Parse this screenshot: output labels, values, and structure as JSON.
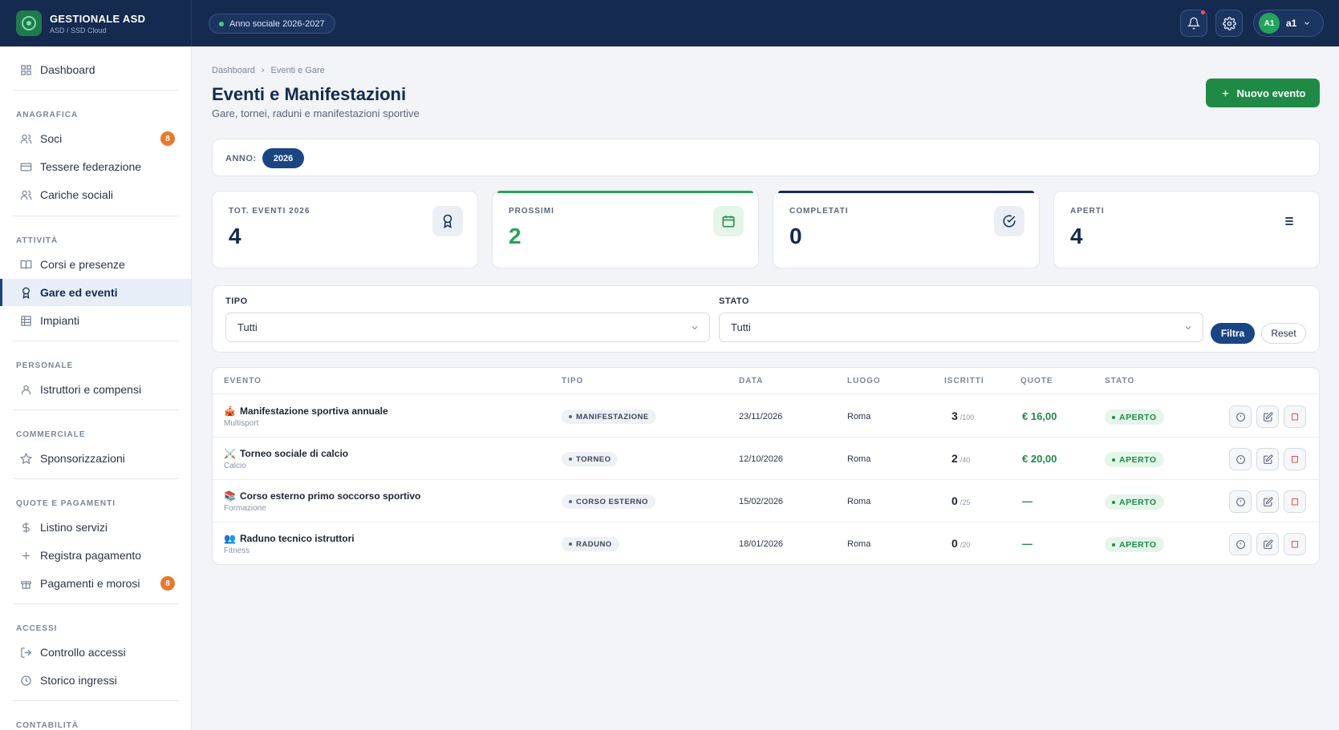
{
  "brand": {
    "title": "GESTIONALE ASD",
    "subtitle": "ASD / SSD Cloud"
  },
  "header": {
    "season": "Anno sociale 2026-2027",
    "user_initials": "A1",
    "user_name": "a1"
  },
  "sidebar": {
    "dashboard": "Dashboard",
    "sections": {
      "anagrafica": "ANAGRAFICA",
      "attivita": "ATTIVITÀ",
      "personale": "PERSONALE",
      "commerciale": "COMMERCIALE",
      "quote": "QUOTE E PAGAMENTI",
      "accessi": "ACCESSI",
      "contabilita": "CONTABILITÀ"
    },
    "items": {
      "soci": "Soci",
      "soci_badge": "8",
      "tessere": "Tessere federazione",
      "cariche": "Cariche sociali",
      "corsi": "Corsi e presenze",
      "gare": "Gare ed eventi",
      "impianti": "Impianti",
      "istruttori": "Istruttori e compensi",
      "sponsor": "Sponsorizzazioni",
      "listino": "Listino servizi",
      "registra": "Registra pagamento",
      "pagamenti": "Pagamenti e morosi",
      "pagamenti_badge": "8",
      "controllo": "Controllo accessi",
      "storico": "Storico ingressi"
    }
  },
  "page": {
    "breadcrumb_home": "Dashboard",
    "breadcrumb_sep": "›",
    "breadcrumb_current": "Eventi e Gare",
    "title": "Eventi e Manifestazioni",
    "subtitle": "Gare, tornei, raduni e manifestazioni sportive",
    "new_button": "Nuovo evento"
  },
  "year_filter": {
    "label": "ANNO:",
    "value": "2026"
  },
  "stats": [
    {
      "label": "TOT. EVENTI 2026",
      "value": "4"
    },
    {
      "label": "PROSSIMI",
      "value": "2"
    },
    {
      "label": "COMPLETATI",
      "value": "0"
    },
    {
      "label": "APERTI",
      "value": "4"
    }
  ],
  "filters": {
    "tipo_label": "TIPO",
    "tipo_value": "Tutti",
    "stato_label": "STATO",
    "stato_value": "Tutti",
    "filter_button": "Filtra",
    "reset_button": "Reset"
  },
  "table": {
    "headers": [
      "EVENTO",
      "TIPO",
      "DATA",
      "LUOGO",
      "ISCRITTI",
      "QUOTE",
      "STATO"
    ],
    "rows": [
      {
        "emoji": "🎪",
        "title": "Manifestazione sportiva annuale",
        "sub": "Multisport",
        "tipo": "MANIFESTAZIONE",
        "data": "23/11/2026",
        "luogo": "Roma",
        "iscritti": "3",
        "max": "/100",
        "quote": "€ 16,00",
        "stato": "APERTO"
      },
      {
        "emoji": "⚔️",
        "title": "Torneo sociale di calcio",
        "sub": "Calcio",
        "tipo": "TORNEO",
        "data": "12/10/2026",
        "luogo": "Roma",
        "iscritti": "2",
        "max": "/40",
        "quote": "€ 20,00",
        "stato": "APERTO"
      },
      {
        "emoji": "📚",
        "title": "Corso esterno primo soccorso sportivo",
        "sub": "Formazione",
        "tipo": "CORSO ESTERNO",
        "data": "15/02/2026",
        "luogo": "Roma",
        "iscritti": "0",
        "max": "/25",
        "quote": "—",
        "stato": "APERTO"
      },
      {
        "emoji": "👥",
        "title": "Raduno tecnico istruttori",
        "sub": "Fitness",
        "tipo": "RADUNO",
        "data": "18/01/2026",
        "luogo": "Roma",
        "iscritti": "0",
        "max": "/20",
        "quote": "—",
        "stato": "APERTO"
      }
    ]
  },
  "colors": {
    "navy": "#142a4e",
    "accent_blue": "#1a4585",
    "green": "#1f8a46",
    "orange": "#e8792b"
  }
}
